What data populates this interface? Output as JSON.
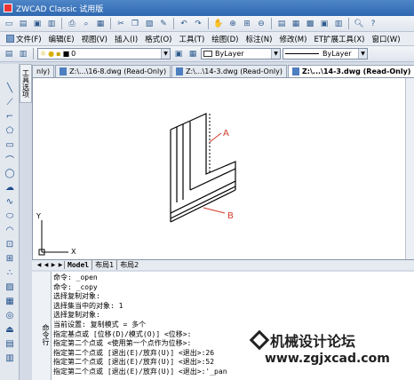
{
  "window": {
    "title": "ZWCAD Classic 试用版"
  },
  "menu": [
    "文件(F)",
    "编辑(E)",
    "视图(V)",
    "插入(I)",
    "格式(O)",
    "工具(T)",
    "绘图(D)",
    "标注(N)",
    "修改(M)",
    "ET扩展工具(X)",
    "窗口(W)"
  ],
  "layer": {
    "current": "0",
    "color": "ByLayer",
    "linetype": "ByLayer"
  },
  "doc_tabs": [
    {
      "label": "nly)",
      "active": false
    },
    {
      "label": "Z:\\...\\16-8.dwg (Read-Only)",
      "active": false
    },
    {
      "label": "Z:\\...\\14-3.dwg (Read-Only)",
      "active": false
    },
    {
      "label": "Z:\\...\\14-3.dwg (Read-Only)",
      "active": true
    }
  ],
  "palette_tab": "工具选项",
  "drawing": {
    "label_a": "A",
    "label_b": "B",
    "axis_x": "X",
    "axis_y": "Y",
    "colors": {
      "annotation": "#d23a2a",
      "geometry": "#000000"
    }
  },
  "layout_tabs": [
    "Model",
    "布局1",
    "布局2"
  ],
  "command_tab": "命令行",
  "command_lines": [
    "命令: _open",
    "命令: _copy",
    "选择复制对象:",
    "选择集当中的对象: 1",
    "选择复制对象:",
    "当前设置: 复制模式 = 多个",
    "指定基点或 [位移(D)/模式(O)] <位移>:",
    "指定第二个点或 <使用第一个点作为位移>:",
    "指定第二个点或 [退出(E)/放弃(U)] <退出>:26",
    "指定第二个点或 [退出(E)/放弃(U)] <退出>:52",
    "指定第二个点或 [退出(E)/放弃(U)] <退出>:'_pan"
  ],
  "watermark": {
    "title": "机械设计论坛",
    "url": "www.zgjxcad.com"
  }
}
